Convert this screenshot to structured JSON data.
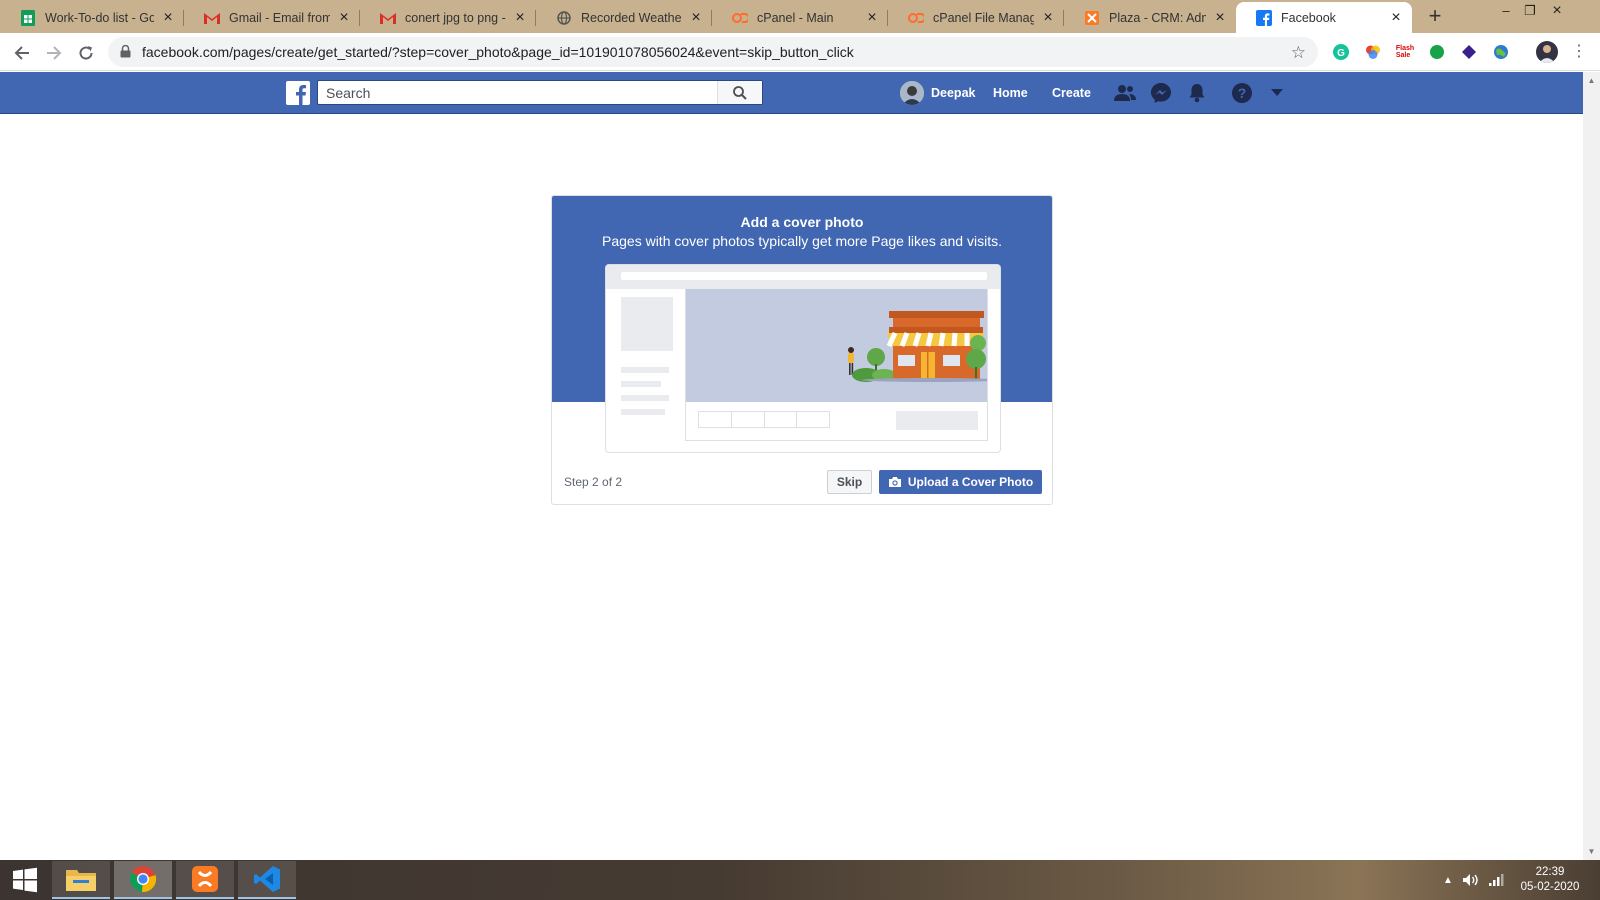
{
  "browser": {
    "tabs": [
      {
        "title": "Work-To-do list - Go",
        "icon": "google-sheets-icon",
        "active": false
      },
      {
        "title": "Gmail - Email from G",
        "icon": "gmail-icon",
        "active": false
      },
      {
        "title": "conert jpg to png - o",
        "icon": "gmail-icon",
        "active": false
      },
      {
        "title": "Recorded Weather",
        "icon": "globe-icon",
        "active": false
      },
      {
        "title": "cPanel - Main",
        "icon": "cpanel-icon",
        "active": false
      },
      {
        "title": "cPanel File Manager",
        "icon": "cpanel-icon",
        "active": false
      },
      {
        "title": "Plaza - CRM: Admin",
        "icon": "xampp-icon",
        "active": false
      },
      {
        "title": "Facebook",
        "icon": "facebook-icon",
        "active": true
      }
    ],
    "url": "facebook.com/pages/create/get_started/?step=cover_photo&page_id=101901078056024&event=skip_button_click",
    "extensions": [
      "grammarly-icon",
      "color-picker-icon",
      "flash-sale-icon",
      "green-leaf-icon",
      "purple-diamond-icon",
      "earth-icon"
    ],
    "flash_sale_label": "Flash Sale"
  },
  "fb": {
    "search_placeholder": "Search",
    "user_name": "Deepak",
    "nav_home": "Home",
    "nav_create": "Create"
  },
  "card": {
    "title": "Add a cover photo",
    "subtitle": "Pages with cover photos typically get more Page likes and visits.",
    "step": "Step 2 of 2",
    "skip_label": "Skip",
    "upload_label": "Upload a Cover Photo"
  },
  "taskbar": {
    "apps": [
      "file-explorer-icon",
      "chrome-icon",
      "xampp-icon",
      "vscode-icon"
    ],
    "time": "22:39",
    "date": "05-02-2020"
  },
  "colors": {
    "facebook_blue": "#4267b2",
    "tabstrip": "#c7b18e"
  }
}
